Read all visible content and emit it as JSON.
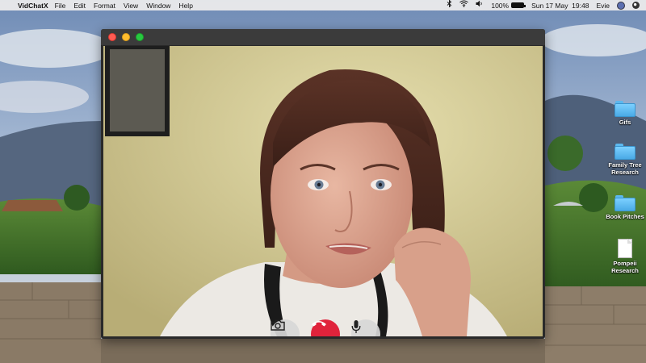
{
  "menubar": {
    "app_name": "VidChatX",
    "menus": [
      "File",
      "Edit",
      "Format",
      "View",
      "Window",
      "Help"
    ],
    "battery_percent": "100%",
    "datetime": "Sun 17 May  19:48",
    "username": "Evie"
  },
  "window": {
    "controls": {
      "camera_icon": "camera-icon",
      "end_call_icon": "phone-hangup-icon",
      "mic_icon": "microphone-icon",
      "end_call_color": "#e0233b"
    }
  },
  "desktop": {
    "icons": [
      {
        "label": "Gifs",
        "type": "folder"
      },
      {
        "label": "Family Tree Research",
        "type": "folder"
      },
      {
        "label": "Book Pitches",
        "type": "folder"
      },
      {
        "label": "Pompeii Research",
        "type": "document"
      }
    ]
  }
}
